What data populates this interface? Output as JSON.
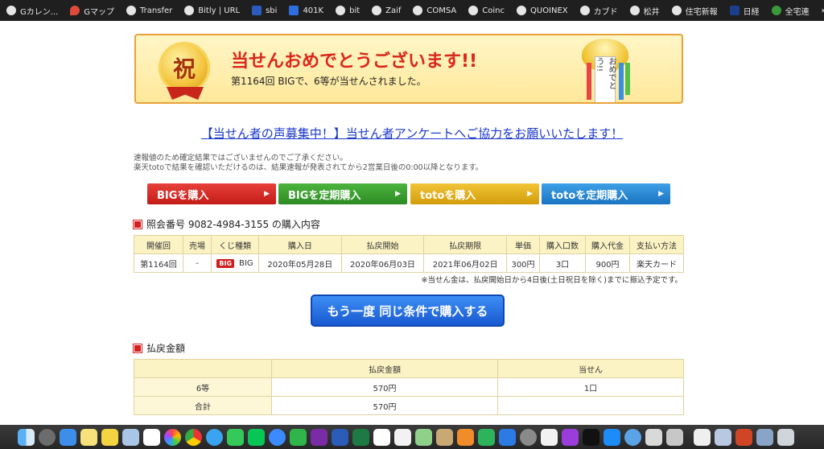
{
  "bookmarks": [
    {
      "label": "Gカレン..."
    },
    {
      "label": "Gマップ"
    },
    {
      "label": "Transfer"
    },
    {
      "label": "Bitly | URL"
    },
    {
      "label": "sbi"
    },
    {
      "label": "401K"
    },
    {
      "label": "bit"
    },
    {
      "label": "Zaif"
    },
    {
      "label": "COMSA"
    },
    {
      "label": "Coinc"
    },
    {
      "label": "QUOINEX"
    },
    {
      "label": "カブド"
    },
    {
      "label": "松井"
    },
    {
      "label": "住宅新報"
    },
    {
      "label": "日経"
    },
    {
      "label": "全宅連"
    }
  ],
  "bookmarks_more": "»",
  "banner": {
    "medal_text": "祝",
    "title": "当せんおめでとうございます!!",
    "subtitle": "第1164回 BIGで、6等が当せんされました。",
    "tag_text": "おめでとう!!"
  },
  "survey_link": "【当せん者の声募集中！】当せん者アンケートへご協力をお願いいたします！",
  "notices": [
    "速報値のため確定結果ではございませんのでご了承ください。",
    "楽天totoで結果を確認いただけるのは、結果速報が発表されてから2営業日後の0:00以降となります。"
  ],
  "buy_buttons": [
    {
      "label": "BIGを購入"
    },
    {
      "label": "BIGを定期購入"
    },
    {
      "label": "totoを購入"
    },
    {
      "label": "totoを定期購入"
    }
  ],
  "purchase_section": {
    "title": "照会番号 9082-4984-3155 の購入内容",
    "headers": [
      "開催回",
      "売場",
      "くじ種類",
      "購入日",
      "払戻開始",
      "払戻期限",
      "単価",
      "購入口数",
      "購入代金",
      "支払い方法"
    ],
    "row": {
      "round": "第1164回",
      "store": "-",
      "lottery_logo": "BIG",
      "lottery": "BIG",
      "purchase_date": "2020年05月28日",
      "payout_start": "2020年06月03日",
      "payout_deadline": "2021年06月02日",
      "unit_price": "300円",
      "units": "3口",
      "total": "900円",
      "payment": "楽天カード"
    },
    "note": "※当せん金は、払戻開始日から4日後(土日祝日を除く)までに振込予定です。"
  },
  "repurchase_button": "もう一度 同じ条件で購入する",
  "payout_section": {
    "title": "払戻金額",
    "headers": [
      "",
      "払戻金額",
      "当せん"
    ],
    "rows": [
      {
        "label": "6等",
        "amount": "570円",
        "count": "1口"
      },
      {
        "label": "合計",
        "amount": "570円",
        "count": ""
      }
    ]
  }
}
